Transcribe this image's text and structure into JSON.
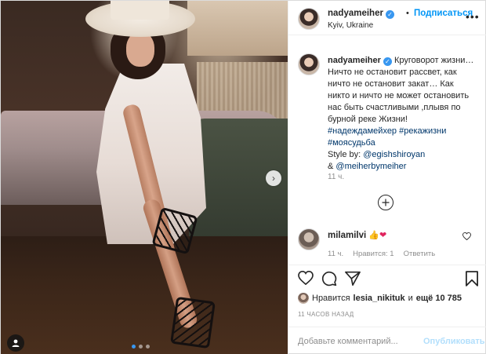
{
  "post": {
    "author": {
      "username": "nadyameiher",
      "verified": true,
      "location": "Kyiv, Ukraine"
    },
    "follow_separator": "•",
    "follow_label": "Подписаться",
    "more_icon": "more-horizontal-icon",
    "photo": {
      "carousel_count": 3,
      "carousel_active": 1,
      "next_icon": "chevron-right-icon",
      "tag_icon": "user-tag-icon"
    },
    "caption": {
      "username": "nadyameiher",
      "lines": [
        "Круговорот жизни…",
        "Ничто не остановит рассвет, как",
        "ничто не остановит закат… Как",
        "никто и ничто не может остановить",
        "нас быть счастливыми ,плывя по",
        "бурной реке Жизни!"
      ],
      "hashtags_line1": "#надеждамейхер #рекажизни",
      "hashtags_line2": "#моясудьба",
      "style_prefix": "Style by: ",
      "style_handle": "@egishshiroyan",
      "amp": "& ",
      "second_handle": "@meiherbymeiher",
      "time": "11 ч."
    },
    "load_more_icon": "plus-circle-icon",
    "comment": {
      "username": "milamilvi",
      "text_emoji_1": "👍",
      "text_emoji_2": "❤",
      "time": "11 ч.",
      "likes": "Нравится: 1",
      "reply": "Ответить"
    },
    "actions": {
      "like_icon": "heart-icon",
      "comment_icon": "comment-icon",
      "share_icon": "paper-plane-icon",
      "save_icon": "bookmark-icon"
    },
    "likes": {
      "prefix": "Нравится ",
      "user": "lesia_nikituk",
      "middle": " и ",
      "count": "ещё 10 785"
    },
    "timestamp": "11 ЧАСОВ НАЗАД",
    "add_comment": {
      "placeholder": "Добавьте комментарий...",
      "publish": "Опубликовать"
    },
    "colors": {
      "accent": "#0095f6",
      "verified": "#3897f0",
      "muted": "#8e8e8e",
      "heart": "#e0245e"
    }
  }
}
